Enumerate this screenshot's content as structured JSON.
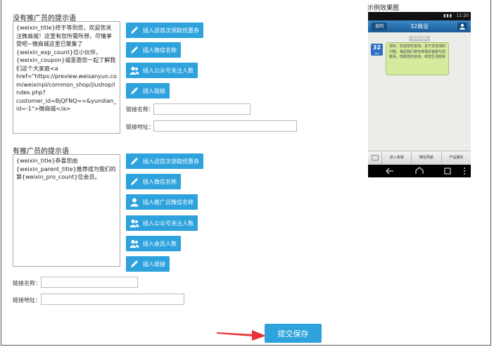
{
  "no_promoter": {
    "title": "没有推广员的提示语",
    "message": "{weixin_title}终于等到您，欢迎您关注微商城！这里有您所需所想，尽情享受吧~微商城这里已聚集了{weixin_exp_count}位小伙伴，{weixin_coupon}诚意邀您一起了解我们这个大家庭<a href=\"https://preview.weisanyun.com/weixinpl/common_shop/jiushop/index.php?customer_id=BjQFNQ==&yundian_id=-1\">微商城</a>",
    "buttons": [
      {
        "label": "插入送首次领取优惠券",
        "icon": "pencil-icon"
      },
      {
        "label": "插入微信名称",
        "icon": "pencil-icon"
      },
      {
        "label": "插入公众号关注人数",
        "icon": "users-icon"
      },
      {
        "label": "插入链接",
        "icon": "pencil-icon"
      }
    ],
    "link_name_label": "链接名称：",
    "link_url_label": "链接地址：",
    "link_name_value": "",
    "link_url_value": ""
  },
  "with_promoter": {
    "title": "有推广员的提示语",
    "message": "{weixin_title}恭喜您由{weixin_parent_title}推荐成为我们的第{weixin_pro_count}位会员。",
    "buttons": [
      {
        "label": "插入送首次领取优惠券",
        "icon": "pencil-icon"
      },
      {
        "label": "插入微信名称",
        "icon": "pencil-icon"
      },
      {
        "label": "插入推广员微信名称",
        "icon": "user-icon"
      },
      {
        "label": "插入公众号关注人数",
        "icon": "users-icon"
      },
      {
        "label": "插入会员人数",
        "icon": "users-icon"
      },
      {
        "label": "插入链接",
        "icon": "pencil-icon"
      }
    ],
    "link_name_label": "链接名称：",
    "link_url_label": "链接地址：",
    "link_name_value": "",
    "link_url_value": ""
  },
  "preview": {
    "title": "示例效果图",
    "status_time": "11:20",
    "back_label": "返回",
    "chat_title": "32商业",
    "timestamp": "下午3:09",
    "avatar_text": "32",
    "avatar_sub": "商业",
    "bubble_text": "您好，欢迎您的咨询，关于您咨询的问题，稍后我们将安排相关客服与您联系，感谢您的咨询，祝您生活愉快",
    "tabs": [
      "进入商城",
      "微信导航",
      "产品服务"
    ]
  },
  "submit_label": "提交保存",
  "colors": {
    "button": "#2da2dd",
    "arrow": "#e8333a"
  }
}
